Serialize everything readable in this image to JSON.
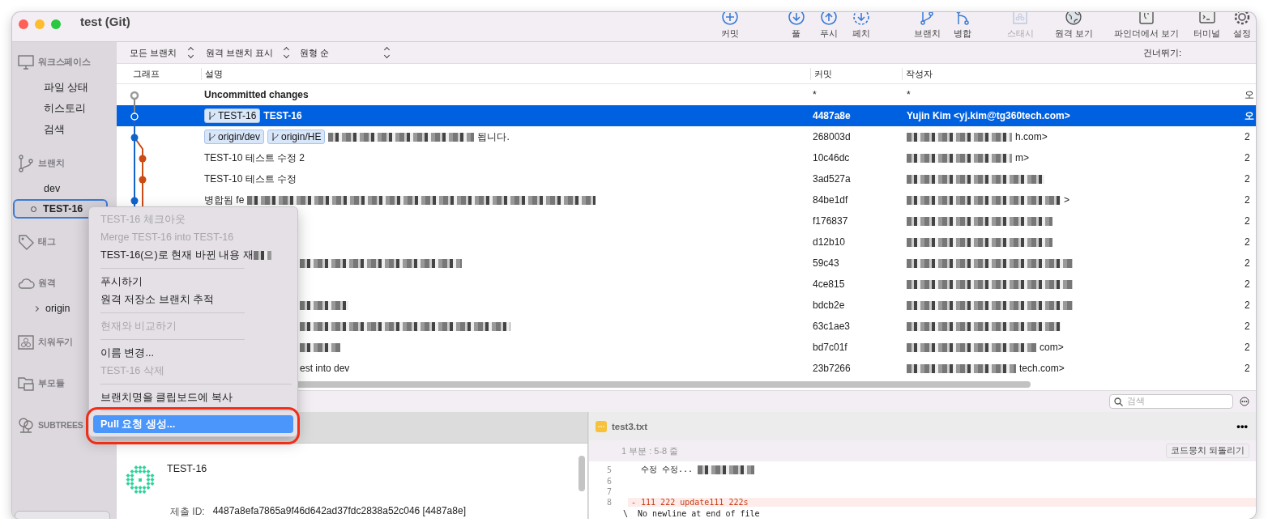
{
  "window": {
    "title": "test (Git)"
  },
  "toolbar": [
    {
      "label": "커밋",
      "disabled": false
    },
    {
      "label": "풀",
      "disabled": false
    },
    {
      "label": "푸시",
      "disabled": false
    },
    {
      "label": "페치",
      "disabled": false
    },
    {
      "label": "브랜치",
      "disabled": false
    },
    {
      "label": "병합",
      "disabled": false
    },
    {
      "label": "스태시",
      "disabled": true
    },
    {
      "label": "원격 보기",
      "disabled": false
    },
    {
      "label": "파인더에서 보기",
      "disabled": false
    },
    {
      "label": "터미널",
      "disabled": false
    },
    {
      "label": "설정",
      "disabled": false
    }
  ],
  "sidebar": {
    "sections": [
      {
        "label": "워크스페이스",
        "items": [
          {
            "label": "파일 상태",
            "selected": false
          },
          {
            "label": "히스토리",
            "selected": false
          },
          {
            "label": "검색",
            "selected": false
          }
        ]
      },
      {
        "label": "브랜치",
        "items": [
          {
            "label": "dev",
            "selected": false
          },
          {
            "label": "TEST-16",
            "selected": true
          }
        ]
      },
      {
        "label": "태그"
      },
      {
        "label": "원격",
        "items": [
          {
            "label": "origin",
            "selected": false
          }
        ]
      },
      {
        "label": "치워두기"
      },
      {
        "label": "부모듈"
      },
      {
        "label": "SUBTREES"
      }
    ]
  },
  "filters": [
    {
      "label": "모든 브랜치"
    },
    {
      "label": "원격 브랜치 표시"
    },
    {
      "label": "원형 순"
    }
  ],
  "jump_label": "건너뛰기:",
  "table": {
    "columns": [
      "그래프",
      "설명",
      "커밋",
      "작성자"
    ],
    "rows": [
      {
        "kind": "uncommitted",
        "tags": [],
        "description": "Uncommitted changes",
        "pixelated": false,
        "covered": false,
        "commit": "*",
        "author": "*",
        "author_pixelated": false,
        "date": "오",
        "selected": false
      },
      {
        "kind": "commit",
        "tags": [
          "TEST-16"
        ],
        "description": "TEST-16",
        "pixelated": false,
        "covered": false,
        "commit": "4487a8e",
        "author": "Yujin Kim <yj.kim@tg360tech.com>",
        "author_pixelated": false,
        "date": "오",
        "selected": true
      },
      {
        "kind": "commit",
        "tags": [
          "origin/dev",
          "origin/HE"
        ],
        "description": "됩니다.",
        "pixelated": true,
        "covered": false,
        "commit": "268003d",
        "author": "h.com>",
        "author_pixelated": true,
        "date": "2",
        "selected": false
      },
      {
        "kind": "commit",
        "tags": [],
        "description": "TEST-10 테스트 수정 2",
        "pixelated": false,
        "covered": false,
        "commit": "10c46dc",
        "author": "m>",
        "author_pixelated": true,
        "date": "2",
        "selected": false
      },
      {
        "kind": "commit",
        "tags": [],
        "description": "TEST-10 테스트 수정",
        "pixelated": false,
        "covered": false,
        "commit": "3ad527a",
        "author_pixelated": true,
        "date": "2",
        "selected": false
      },
      {
        "kind": "commit",
        "tags": [],
        "description": "병합됨 fe",
        "pixelated": true,
        "covered": false,
        "commit": "84be1df",
        "author": ">",
        "author_pixelated": true,
        "date": "2",
        "selected": false
      },
      {
        "kind": "commit",
        "tags": [],
        "description": "",
        "pixelated": false,
        "covered": true,
        "commit": "f176837",
        "author": "",
        "author_pixelated": true,
        "date": "2",
        "selected": false
      },
      {
        "kind": "commit",
        "tags": [],
        "description": "",
        "pixelated": false,
        "covered": true,
        "commit": "d12b10",
        "author": "",
        "author_pixelated": true,
        "date": "2",
        "selected": false
      },
      {
        "kind": "commit",
        "tags": [],
        "description": "",
        "pixelated": true,
        "covered": true,
        "commit": "59c43",
        "author": "",
        "author_pixelated": true,
        "date": "2",
        "selected": false
      },
      {
        "kind": "commit",
        "tags": [],
        "description": "",
        "pixelated": false,
        "covered": true,
        "commit": "4ce815",
        "author": "",
        "author_pixelated": true,
        "date": "2",
        "selected": false
      },
      {
        "kind": "commit",
        "tags": [],
        "description": "",
        "pixelated": true,
        "covered": true,
        "commit": "bdcb2e",
        "author": "",
        "author_pixelated": true,
        "date": "2",
        "selected": false
      },
      {
        "kind": "commit",
        "tags": [],
        "description": "",
        "pixelated": true,
        "covered": true,
        "commit": "63c1ae3",
        "author": "",
        "author_pixelated": true,
        "date": "2",
        "selected": false
      },
      {
        "kind": "commit",
        "tags": [],
        "description": "",
        "pixelated": true,
        "covered": true,
        "commit": "bd7c01f",
        "author": "com>",
        "author_pixelated": true,
        "date": "2",
        "selected": false
      },
      {
        "kind": "commit",
        "tags": [],
        "description": "est into dev",
        "pixelated": false,
        "covered": true,
        "commit": "23b7266",
        "author": "tech.com>",
        "author_pixelated": true,
        "date": "2",
        "selected": false
      }
    ]
  },
  "context_menu": [
    {
      "kind": "item",
      "label": "TEST-16 체크아웃",
      "disabled": true,
      "selected": false
    },
    {
      "kind": "item",
      "label": "Merge TEST-16 into TEST-16",
      "disabled": true,
      "selected": false
    },
    {
      "kind": "item",
      "label": "TEST-16(으)로 현재 바뀐 내용 재",
      "disabled": false,
      "selected": false
    },
    {
      "kind": "separator"
    },
    {
      "kind": "item",
      "label": "푸시하기",
      "disabled": false,
      "selected": false
    },
    {
      "kind": "item",
      "label": "원격 저장소 브랜치 추적",
      "disabled": false,
      "selected": false
    },
    {
      "kind": "separator"
    },
    {
      "kind": "item",
      "label": "현재와 비교하기",
      "disabled": true,
      "selected": false
    },
    {
      "kind": "separator"
    },
    {
      "kind": "item",
      "label": "이름 변경...",
      "disabled": false,
      "selected": false
    },
    {
      "kind": "item",
      "label": "TEST-16 삭제",
      "disabled": true,
      "selected": false
    },
    {
      "kind": "separator"
    },
    {
      "kind": "item",
      "label": "브랜치명을 클립보드에 복사",
      "disabled": false,
      "selected": false
    },
    {
      "kind": "separator"
    },
    {
      "kind": "item",
      "label": "Pull 요청 생성...",
      "disabled": false,
      "selected": true
    }
  ],
  "search": {
    "placeholder": "검색"
  },
  "commit_detail": {
    "subject": "TEST-16",
    "id_label": "제출 ID:",
    "id_value": "4487a8efa7865a9f46d642ad37fdc2838a52c046 [4487a8e]"
  },
  "diff": {
    "file": "test3.txt",
    "more": "•••",
    "hunk": "1 부분 : 5-8 줄",
    "revert_button": "코드뭉치 되돌리기",
    "lines": [
      {
        "kind": "context",
        "number": "5",
        "text": "수정 수정..."
      },
      {
        "kind": "context",
        "number": "6"
      },
      {
        "kind": "context",
        "number": "7"
      },
      {
        "kind": "removed",
        "number": "8",
        "text": "- 111 222 update111 222s"
      },
      {
        "kind": "note",
        "text": "\\  No newline at end of file"
      }
    ]
  }
}
